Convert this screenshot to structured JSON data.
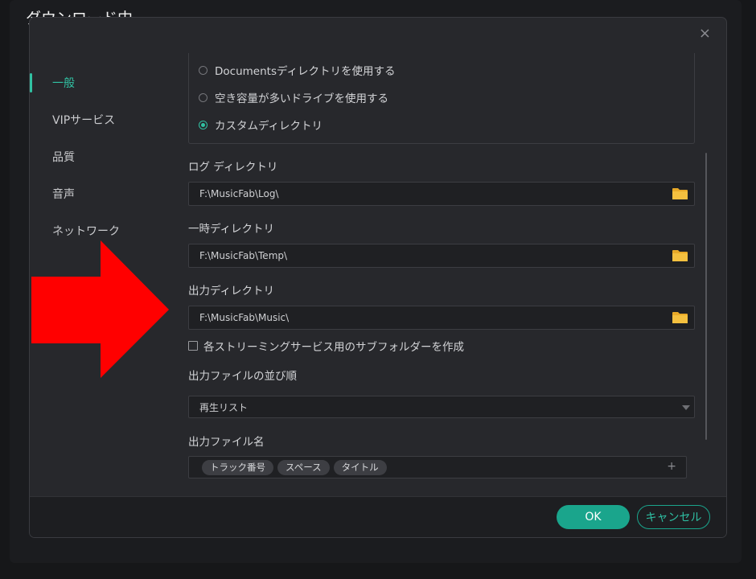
{
  "background": {
    "title": "ダウンロード中"
  },
  "dialog": {
    "close_icon": "×",
    "sidebar": {
      "items": [
        {
          "label": "一般",
          "active": true
        },
        {
          "label": "VIPサービス",
          "active": false
        },
        {
          "label": "品質",
          "active": false
        },
        {
          "label": "音声",
          "active": false
        },
        {
          "label": "ネットワーク",
          "active": false
        }
      ]
    },
    "storage_options": {
      "documents": "Documentsディレクトリを使用する",
      "most_free": "空き容量が多いドライブを使用する",
      "custom": "カスタムディレクトリ",
      "selected": "custom"
    },
    "log_dir": {
      "label": "ログ ディレクトリ",
      "value": "F:\\MusicFab\\Log\\"
    },
    "temp_dir": {
      "label": "一時ディレクトリ",
      "value": "F:\\MusicFab\\Temp\\"
    },
    "output_dir": {
      "label": "出力ディレクトリ",
      "value": "F:\\MusicFab\\Music\\"
    },
    "subfolder_checkbox": {
      "label": "各ストリーミングサービス用のサブフォルダーを作成",
      "checked": false
    },
    "sort_order": {
      "label": "出力ファイルの並び順",
      "value": "再生リスト"
    },
    "file_name": {
      "label": "出力ファイル名",
      "tags": [
        "トラック番号",
        "スペース",
        "タイトル"
      ],
      "add_icon": "+"
    },
    "footer": {
      "ok_label": "OK",
      "cancel_label": "キャンセル"
    }
  },
  "colors": {
    "accent": "#31c2a3",
    "button": "#1aa58c",
    "folder": "#f4c03f",
    "annotation_arrow": "#ff0000"
  },
  "icons": {
    "folder": "folder-icon",
    "close": "close-icon",
    "plus": "plus-icon",
    "dropdown": "chevron-down-icon"
  }
}
